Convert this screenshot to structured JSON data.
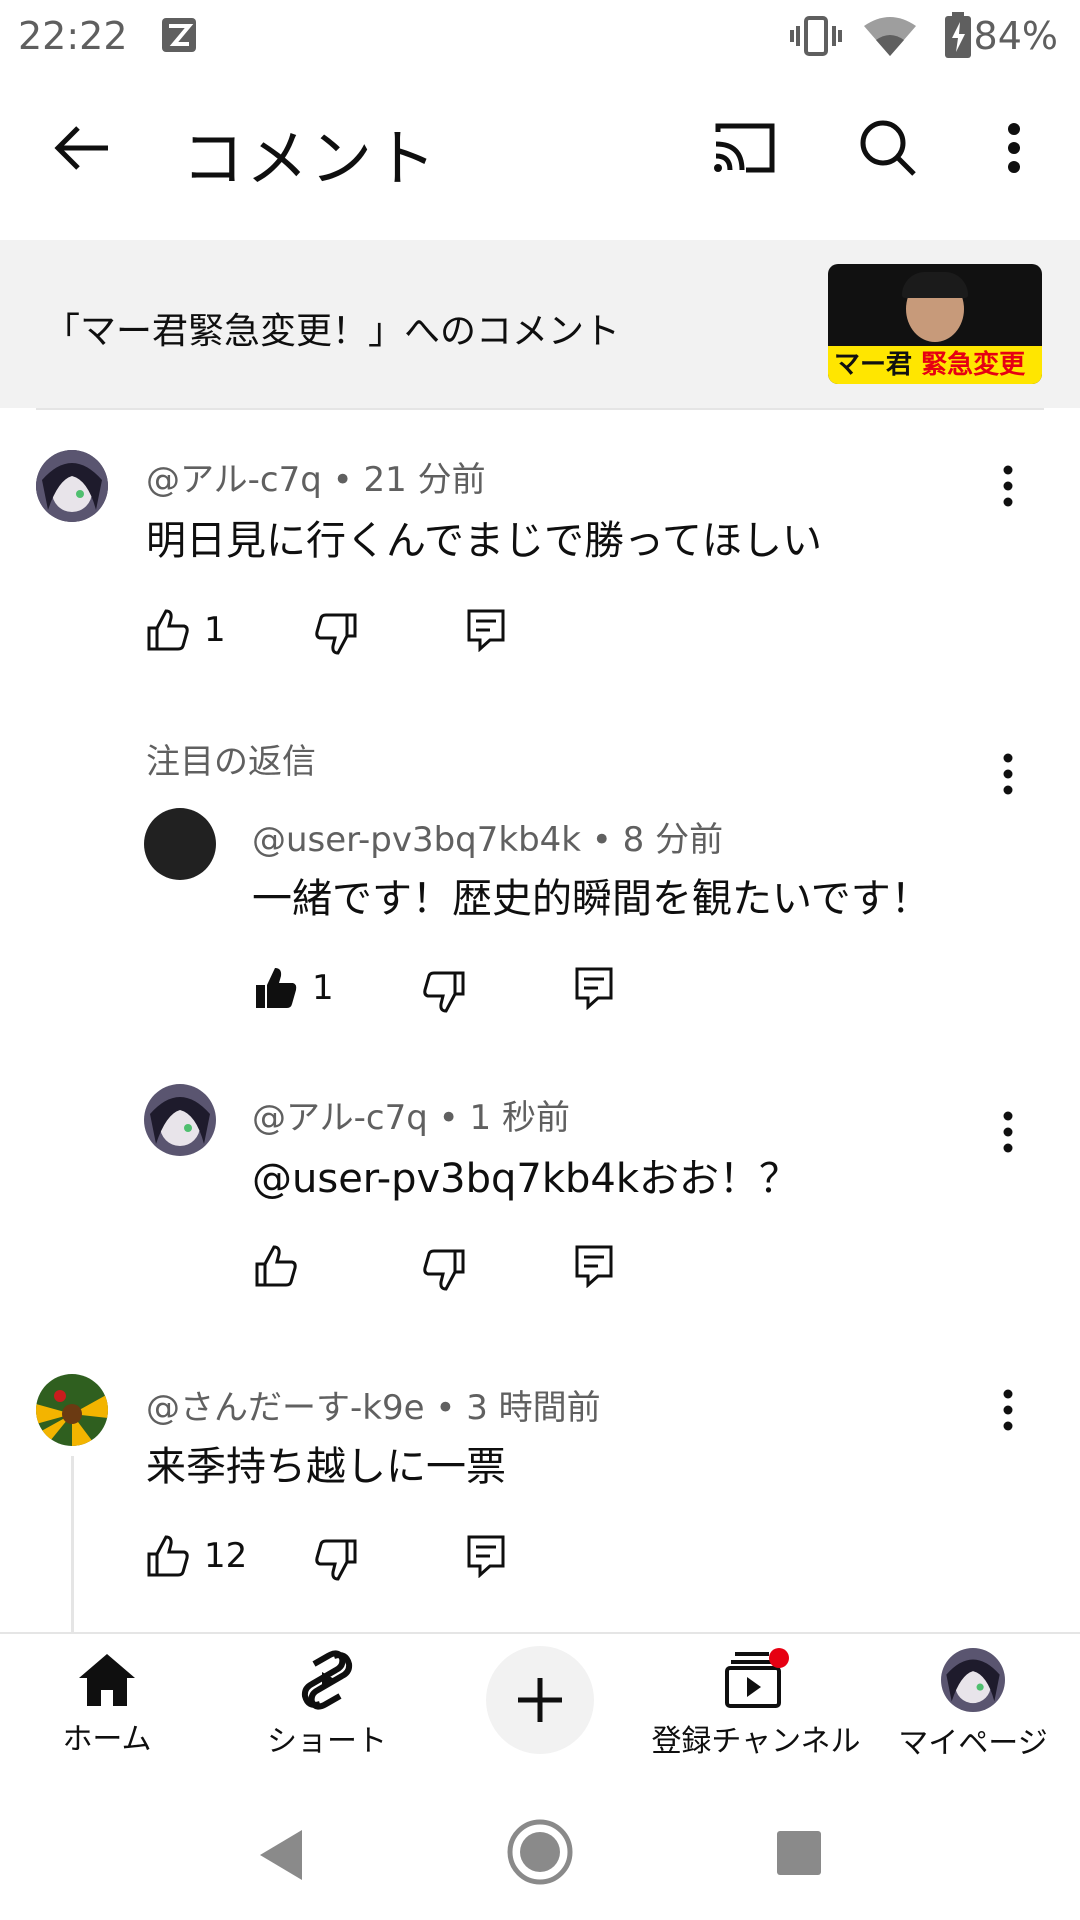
{
  "status_bar": {
    "time": "22:22",
    "battery": "84%",
    "icons": [
      "app-notification-icon",
      "vibrate-icon",
      "wifi-icon",
      "battery-charging-icon"
    ]
  },
  "app_bar": {
    "title": "コメント",
    "icons": [
      "back-arrow-icon",
      "cast-icon",
      "search-icon",
      "more-vert-icon"
    ]
  },
  "video": {
    "comments_title": "「マー君緊急変更！」へのコメント",
    "thumbnail_text_1": "マー君",
    "thumbnail_text_2": "緊急変更"
  },
  "comments": [
    {
      "author": "@アル-c7q",
      "time": "21 分前",
      "text": "明日見に行くんでまじで勝ってほしい",
      "likes": "1"
    },
    {
      "author": "@さんだーす-k9e",
      "time": "3 時間前",
      "text": "来季持ち越しに一票",
      "likes": "12"
    }
  ],
  "replies_section": {
    "label": "注目の返信",
    "replies": [
      {
        "author": "@user-pv3bq7kb4k",
        "time": "8 分前",
        "text": "一緒です！歴史的瞬間を観たいです！",
        "likes": "1",
        "liked": true
      },
      {
        "author": "@アル-c7q",
        "time": "1 秒前",
        "text": "@user-pv3bq7kb4kおお！？",
        "likes": ""
      }
    ]
  },
  "meta_separator": "•",
  "bottom_nav": {
    "home": "ホーム",
    "shorts": "ショート",
    "subscriptions": "登録チャンネル",
    "mypage": "マイページ"
  },
  "colors": {
    "text_primary": "#0f0f0f",
    "text_secondary": "#606060",
    "header_bg": "#f2f2f2",
    "notification_dot": "#e60012"
  }
}
